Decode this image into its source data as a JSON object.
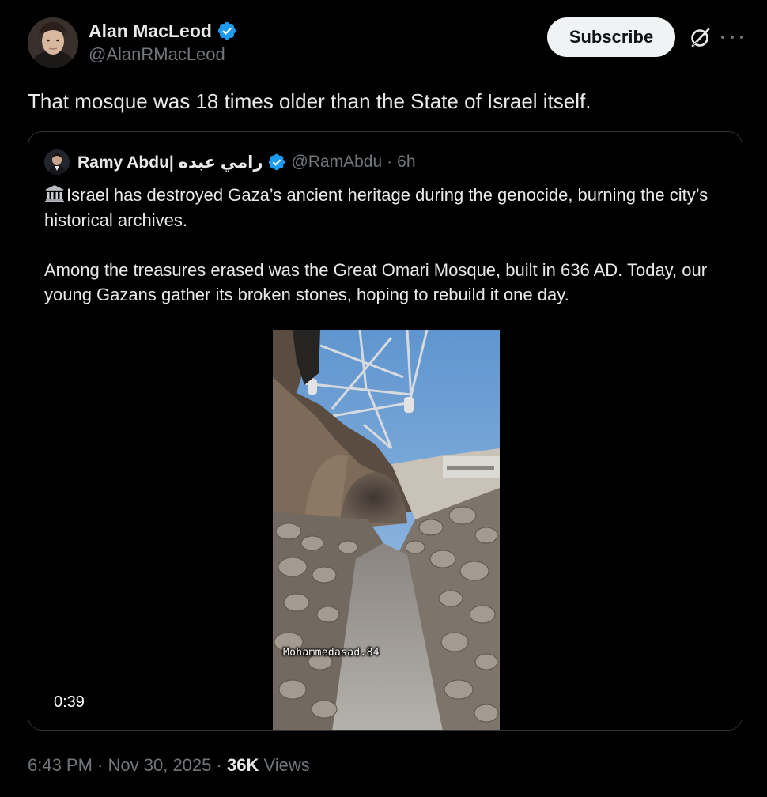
{
  "author": {
    "name": "Alan MacLeod",
    "handle": "@AlanRMacLeod",
    "verified": true
  },
  "actions": {
    "subscribe_label": "Subscribe",
    "grok_icon": "grok-icon",
    "more_icon": "more-icon"
  },
  "tweet": {
    "text": "That mosque was 18 times older than the State of Israel itself."
  },
  "quote": {
    "name": "Ramy Abdu| رامي عبده",
    "handle": "@RamAbdu",
    "separator": "·",
    "time": "6h",
    "verified": true,
    "paragraph1": "Israel has destroyed Gaza’s ancient heritage during the genocide, burning the city’s historical archives.",
    "paragraph2": "Among the treasures erased was the Great Omari Mosque, built in 636 AD. Today, our young Gazans gather its broken stones, hoping to rebuild it one day.",
    "leading_emoji": "classical-building-icon"
  },
  "video": {
    "watermark": "Mohammedasad.84",
    "duration": "0:39"
  },
  "meta": {
    "time": "6:43 PM",
    "sep1": "·",
    "date": "Nov 30, 2025",
    "sep2": "·",
    "views_count": "36K",
    "views_label": "Views"
  },
  "colors": {
    "background": "#000000",
    "text_primary": "#e7e9ea",
    "text_secondary": "#71767b",
    "verified_blue": "#1d9bf0",
    "border": "#2f3336",
    "subscribe_bg": "#eff3f4"
  }
}
